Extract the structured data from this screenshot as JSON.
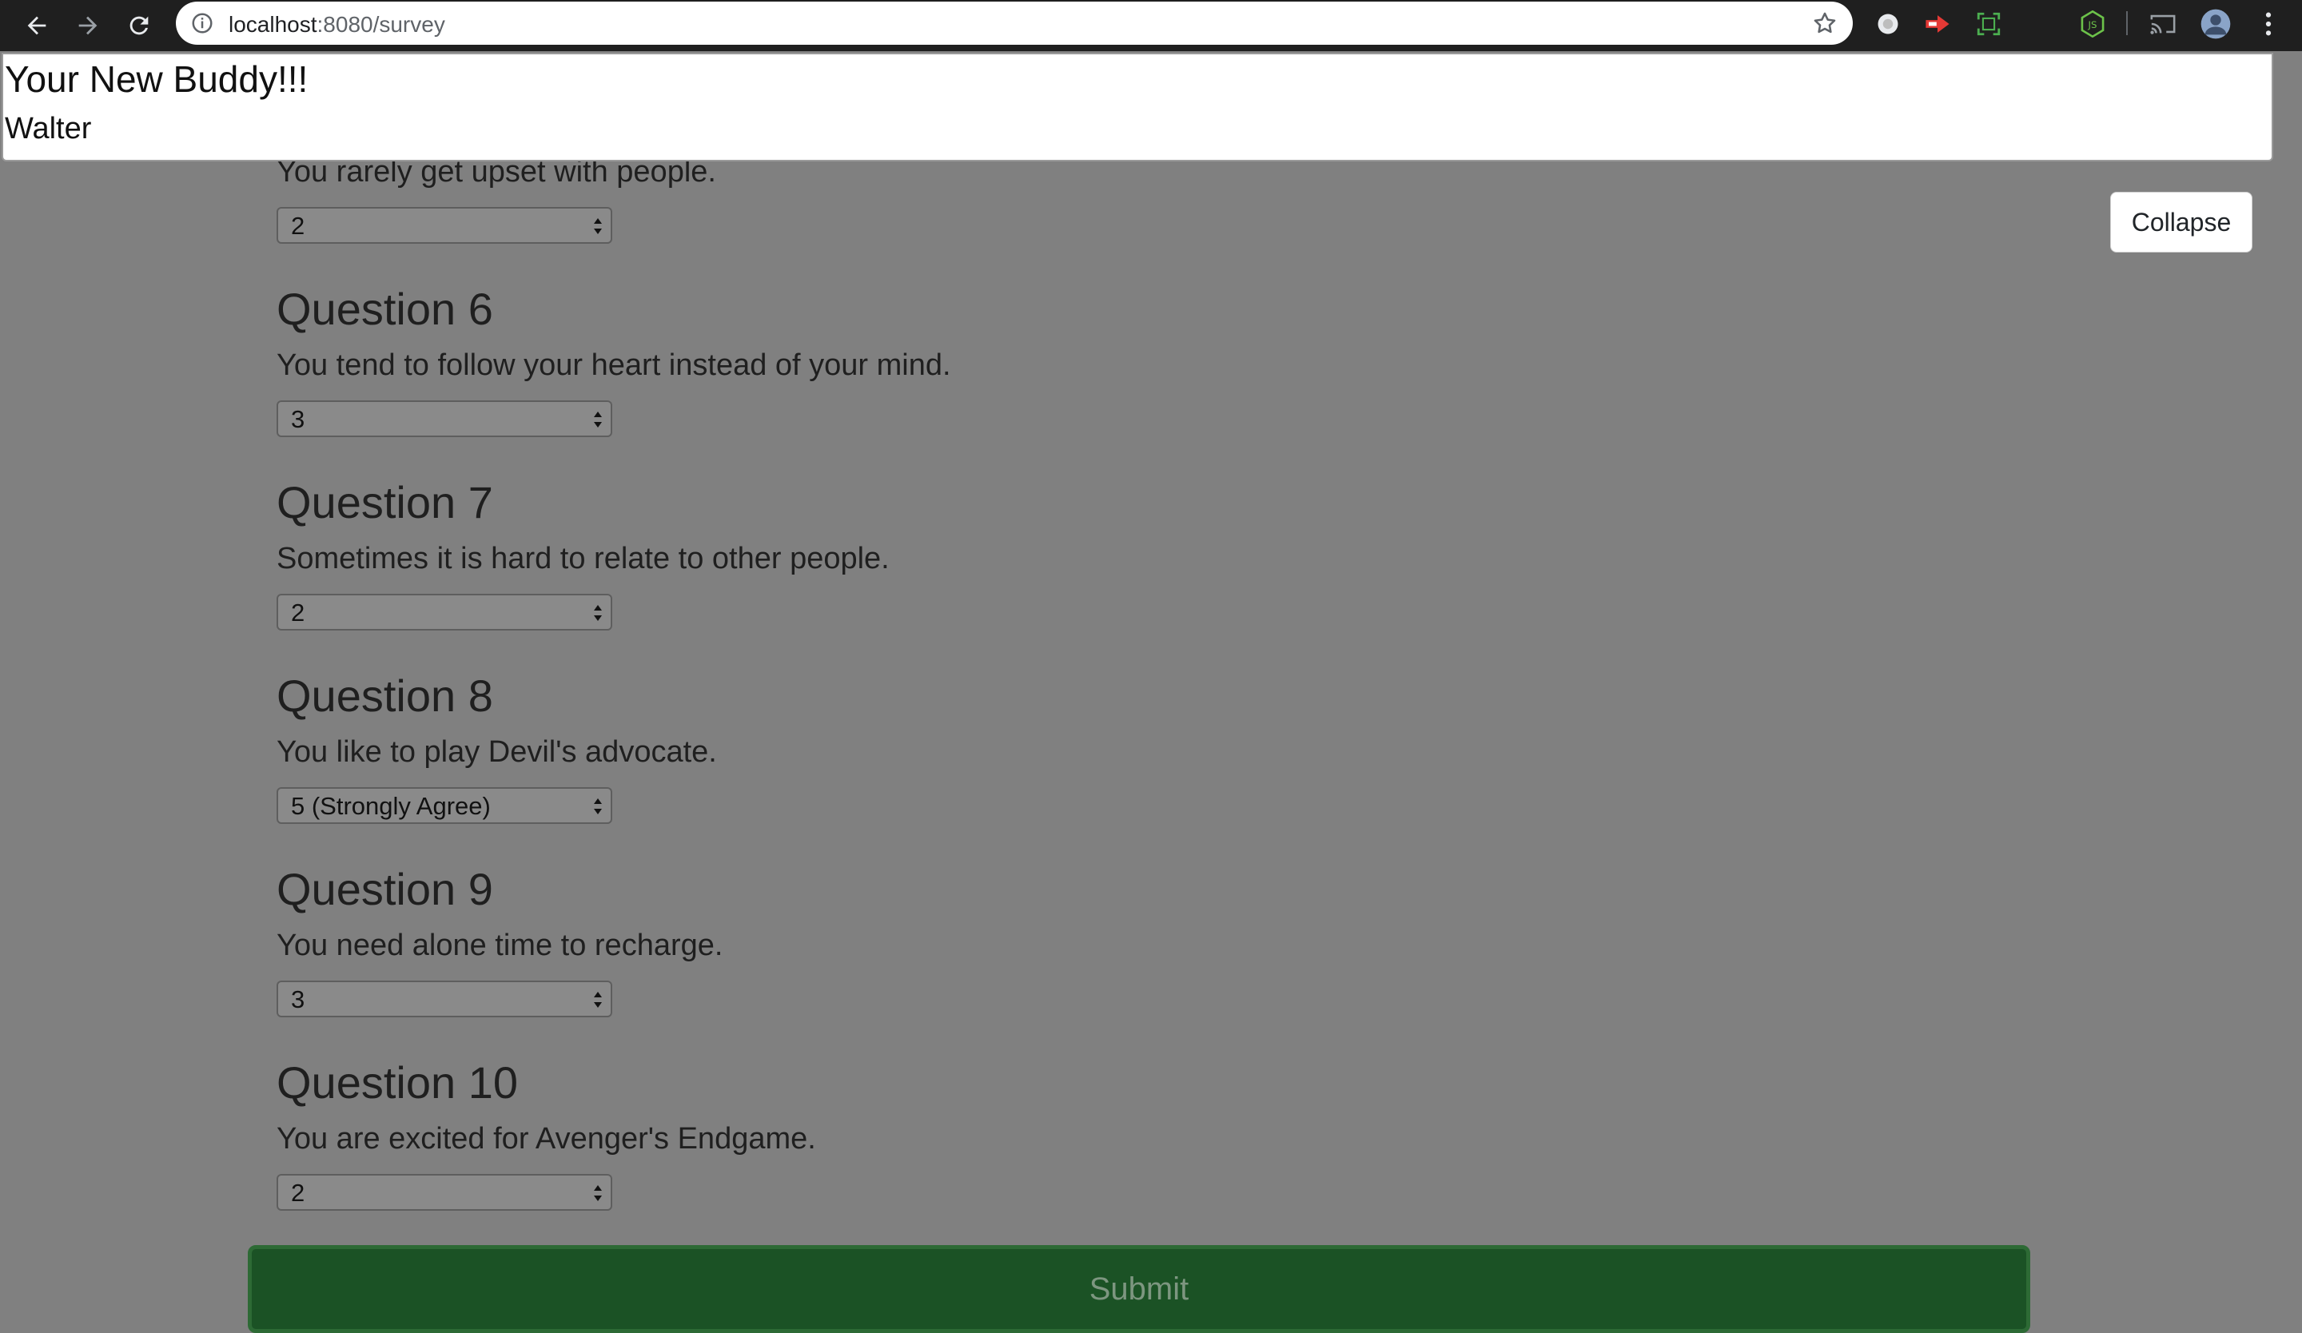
{
  "browser": {
    "url_host": "localhost",
    "url_rest": ":8080/survey"
  },
  "buddy": {
    "heading": "Your New Buddy!!!",
    "name": "Walter"
  },
  "collapse_label": "Collapse",
  "questions": [
    {
      "title": "",
      "text": "You rarely get upset with people.",
      "value": "2"
    },
    {
      "title": "Question 6",
      "text": "You tend to follow your heart instead of your mind.",
      "value": "3"
    },
    {
      "title": "Question 7",
      "text": "Sometimes it is hard to relate to other people.",
      "value": "2"
    },
    {
      "title": "Question 8",
      "text": "You like to play Devil's advocate.",
      "value": "5 (Strongly Agree)"
    },
    {
      "title": "Question 9",
      "text": "You need alone time to recharge.",
      "value": "3"
    },
    {
      "title": "Question 10",
      "text": "You are excited for Avenger's Endgame.",
      "value": "2"
    }
  ],
  "submit_label": "Submit",
  "colors": {
    "overlay": "#808080",
    "submit_bg": "#1b5225"
  }
}
